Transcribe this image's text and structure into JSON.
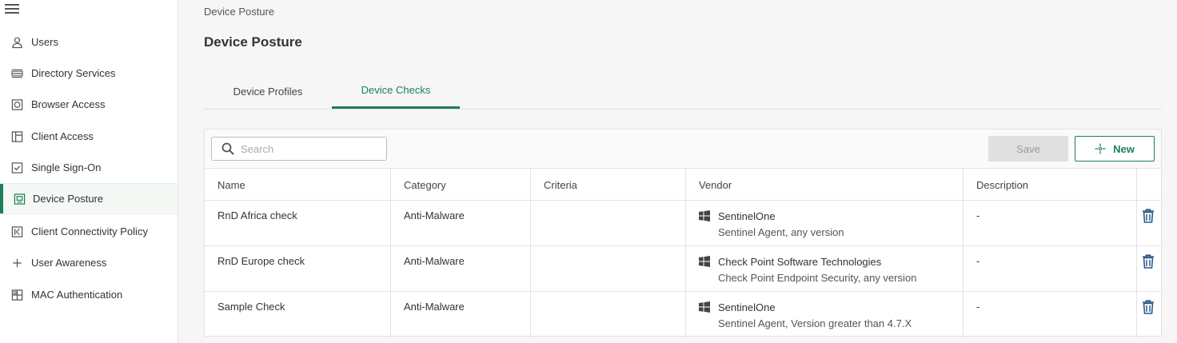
{
  "sidebar": {
    "items": [
      {
        "label": "Users",
        "icon": "user-icon"
      },
      {
        "label": "Directory Services",
        "icon": "directory-icon"
      },
      {
        "label": "Browser Access",
        "icon": "browser-icon"
      },
      {
        "label": "Client Access",
        "icon": "client-icon"
      },
      {
        "label": "Single Sign-On",
        "icon": "checkbox-icon"
      },
      {
        "label": "Device Posture",
        "icon": "monitor-icon"
      },
      {
        "label": "Client Connectivity Policy",
        "icon": "connectivity-icon"
      },
      {
        "label": "User Awareness",
        "icon": "plus-icon"
      },
      {
        "label": "MAC Authentication",
        "icon": "grid-icon"
      }
    ],
    "active": "Device Posture"
  },
  "breadcrumb": "Device Posture",
  "page_title": "Device Posture",
  "tabs": [
    {
      "label": "Device Profiles"
    },
    {
      "label": "Device Checks"
    }
  ],
  "active_tab": "Device Checks",
  "toolbar": {
    "search_placeholder": "Search",
    "save_label": "Save",
    "new_label": "New"
  },
  "table": {
    "columns": [
      "Name",
      "Category",
      "Criteria",
      "Vendor",
      "Description"
    ],
    "rows": [
      {
        "name": "RnD Africa check",
        "category": "Anti-Malware",
        "criteria": "",
        "vendor": "SentinelOne",
        "vendor_detail": "Sentinel Agent, any version",
        "description": "-"
      },
      {
        "name": "RnD Europe check",
        "category": "Anti-Malware",
        "criteria": "",
        "vendor": "Check Point Software Technologies",
        "vendor_detail": "Check Point Endpoint Security, any version",
        "description": "-"
      },
      {
        "name": "Sample Check",
        "category": "Anti-Malware",
        "criteria": "",
        "vendor": "SentinelOne",
        "vendor_detail": "Sentinel Agent, Version greater than 4.7.X",
        "description": "-"
      }
    ]
  },
  "colors": {
    "accent": "#1e7f55",
    "trash": "#2b5a8a"
  }
}
